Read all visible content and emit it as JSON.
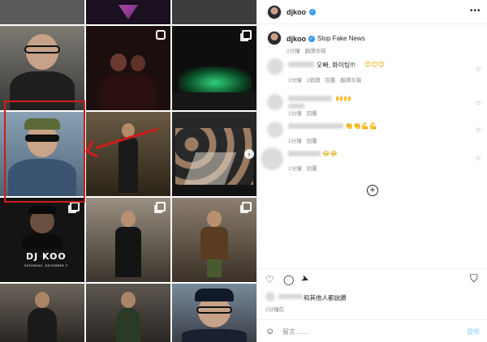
{
  "post": {
    "author": "djkoo",
    "caption_author": "djkoo",
    "caption": "Stop Fake News",
    "caption_time": "2分鐘",
    "caption_translate": "翻譯年糕"
  },
  "comments": [
    {
      "text": "오빠, 화이팅!!!",
      "emoji": "😊😊😊",
      "time": "1分鐘",
      "likes": "1個讚",
      "reply": "回覆",
      "translate": "翻譯年糕"
    },
    {
      "text": "",
      "emoji": "🙌🙌",
      "time": "1分鐘",
      "likes": "",
      "reply": "回覆",
      "translate": ""
    },
    {
      "text": "",
      "emoji": "👏👏💪💪",
      "time": "1分鐘",
      "likes": "",
      "reply": "回覆",
      "translate": ""
    },
    {
      "text": "",
      "emoji": "😂😂",
      "time": "1分鐘",
      "likes": "",
      "reply": "回覆",
      "translate": ""
    }
  ],
  "footer": {
    "liked_by": "和其他人都說讚",
    "time": "2分鐘前",
    "comment_placeholder": "留言……",
    "post_label": "發佈"
  },
  "grid": {
    "promo_title": "DJ KOO",
    "promo_sub": "SATURDAY, DECEMBER 3"
  },
  "colors": {
    "highlight": "#d01b1b",
    "verified": "#3897f0",
    "post_button": "#b2dffc"
  }
}
